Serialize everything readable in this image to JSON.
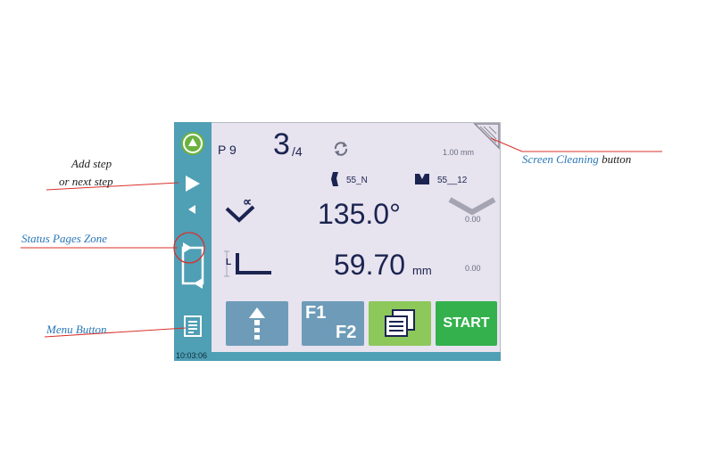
{
  "screen": {
    "program_label": "P 9",
    "step_current": "3",
    "step_total": "/4",
    "thickness": "1.00 mm",
    "punch_label": "55_N",
    "die_label": "55__12",
    "angle_value": "135.0°",
    "angle_correction": "0.00",
    "length_value": "59.70",
    "length_unit": "mm",
    "length_correction": "0.00",
    "clock": "10:03:06",
    "f1_label": "F1",
    "f2_label": "F2",
    "start_label": "START",
    "angle_symbol": "∝",
    "length_symbol": "L"
  },
  "callouts": {
    "add_step_line1": "Add step",
    "add_step_line2": "or next step",
    "status_pages": "Status Pages Zone",
    "menu_button": "Menu Button",
    "screen_cleaning_blue": "Screen Cleaning",
    "screen_cleaning_black": " button"
  },
  "colors": {
    "sidebar": "#4f9fb5",
    "screen_bg": "#e7e3ef",
    "button_blue": "#6e9cb8",
    "button_green_light": "#8cc85a",
    "button_green": "#34b14d",
    "callout_line": "#d9302a",
    "callout_blue": "#2a77b8"
  }
}
